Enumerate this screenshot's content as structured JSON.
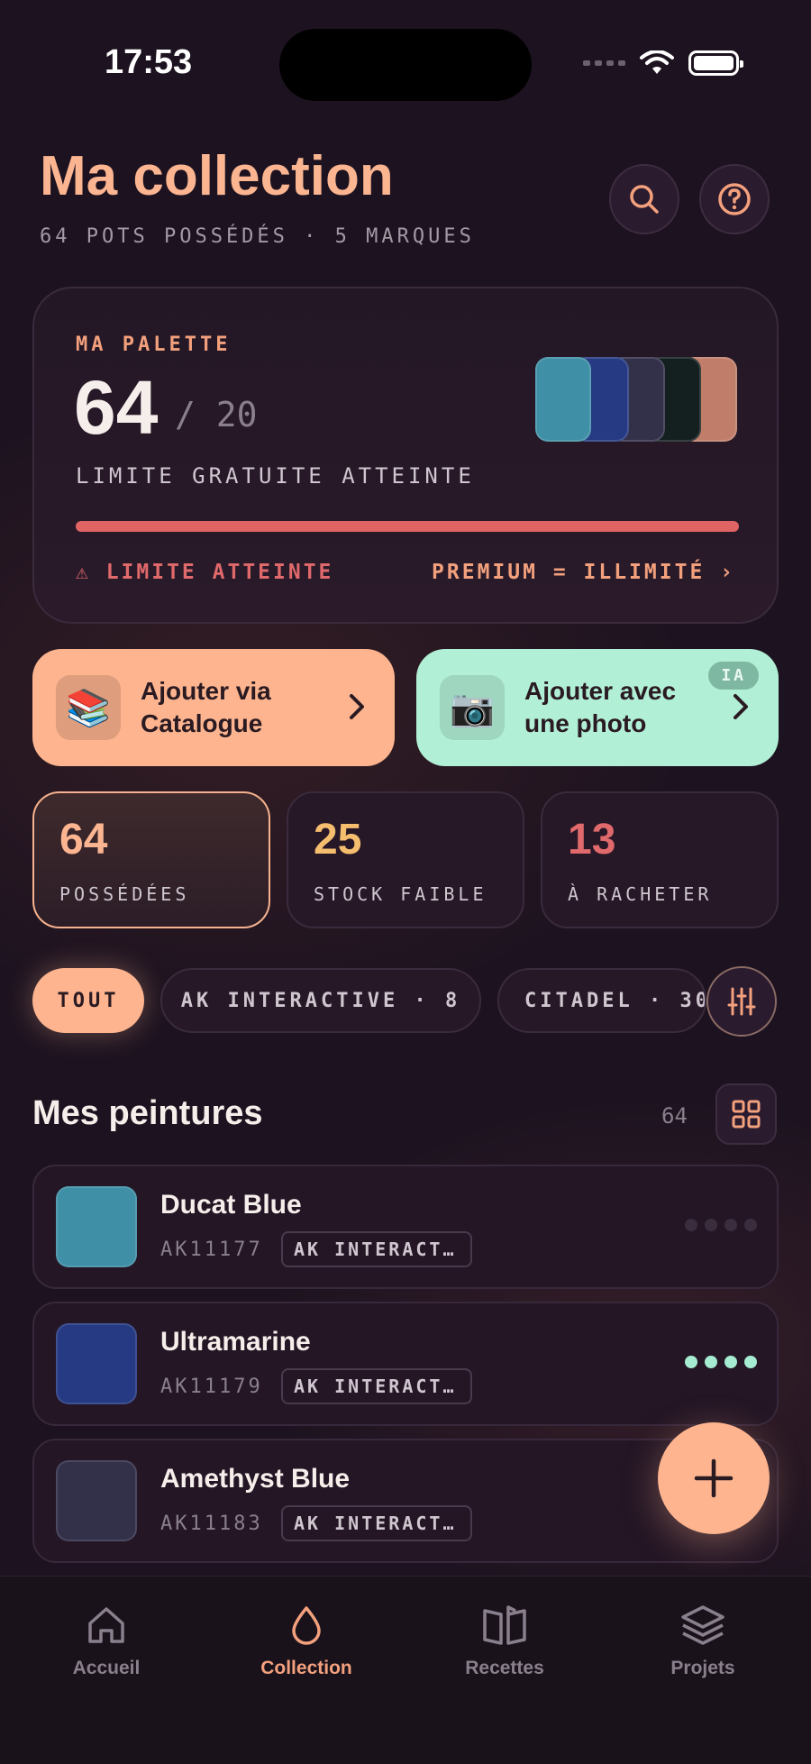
{
  "status_bar": {
    "time": "17:53"
  },
  "header": {
    "title": "Ma collection",
    "subtitle": "64 POTS POSSÉDÉS · 5 MARQUES",
    "icons": [
      "search-icon",
      "help-icon"
    ]
  },
  "palette": {
    "label": "MA PALETTE",
    "count": "64",
    "max": "/ 20",
    "limit_text": "LIMITE GRATUITE ATTEINTE",
    "progress": 1.0,
    "warning": "⚠ LIMITE ATTEINTE",
    "premium": "PREMIUM = ILLIMITÉ ›",
    "swatches": [
      "#3f8fa6",
      "#253a82",
      "#33304a",
      "#142020",
      "#c07e6a"
    ],
    "bar_color": "#e06464"
  },
  "actions": {
    "catalog_label": "Ajouter via Catalogue",
    "catalog_icon": "books-icon",
    "photo_label": "Ajouter avec une photo",
    "photo_icon": "camera-icon",
    "photo_badge": "IA"
  },
  "stats": [
    {
      "value": "64",
      "caption": "POSSÉDÉES",
      "color": "#fbb591"
    },
    {
      "value": "25",
      "caption": "STOCK FAIBLE",
      "color": "#f5be6e"
    },
    {
      "value": "13",
      "caption": "À RACHETER",
      "color": "#e0696b"
    }
  ],
  "filters": {
    "all": "TOUT",
    "ak": "AK INTERACTIVE · 8",
    "citadel": "CITADEL · 30"
  },
  "list": {
    "title": "Mes peintures",
    "count": "64",
    "items": [
      {
        "name": "Ducat Blue",
        "code": "AK11177",
        "brand": "AK INTERACT…",
        "color": "#3f8fa6",
        "level_color": "#3a2d3e"
      },
      {
        "name": "Ultramarine",
        "code": "AK11179",
        "brand": "AK INTERACT…",
        "color": "#253a82",
        "level_color": "#a6ecd2"
      },
      {
        "name": "Amethyst Blue",
        "code": "AK11183",
        "brand": "AK INTERACT…",
        "color": "#33304a",
        "level_color": "#a6ecd2"
      }
    ]
  },
  "tabs": [
    {
      "label": "Accueil",
      "icon": "home-icon"
    },
    {
      "label": "Collection",
      "icon": "drop-icon"
    },
    {
      "label": "Recettes",
      "icon": "book-icon"
    },
    {
      "label": "Projets",
      "icon": "layers-icon"
    }
  ],
  "colors": {
    "accent": "#fbb591",
    "mint": "#b1efd6",
    "danger": "#e06464"
  }
}
